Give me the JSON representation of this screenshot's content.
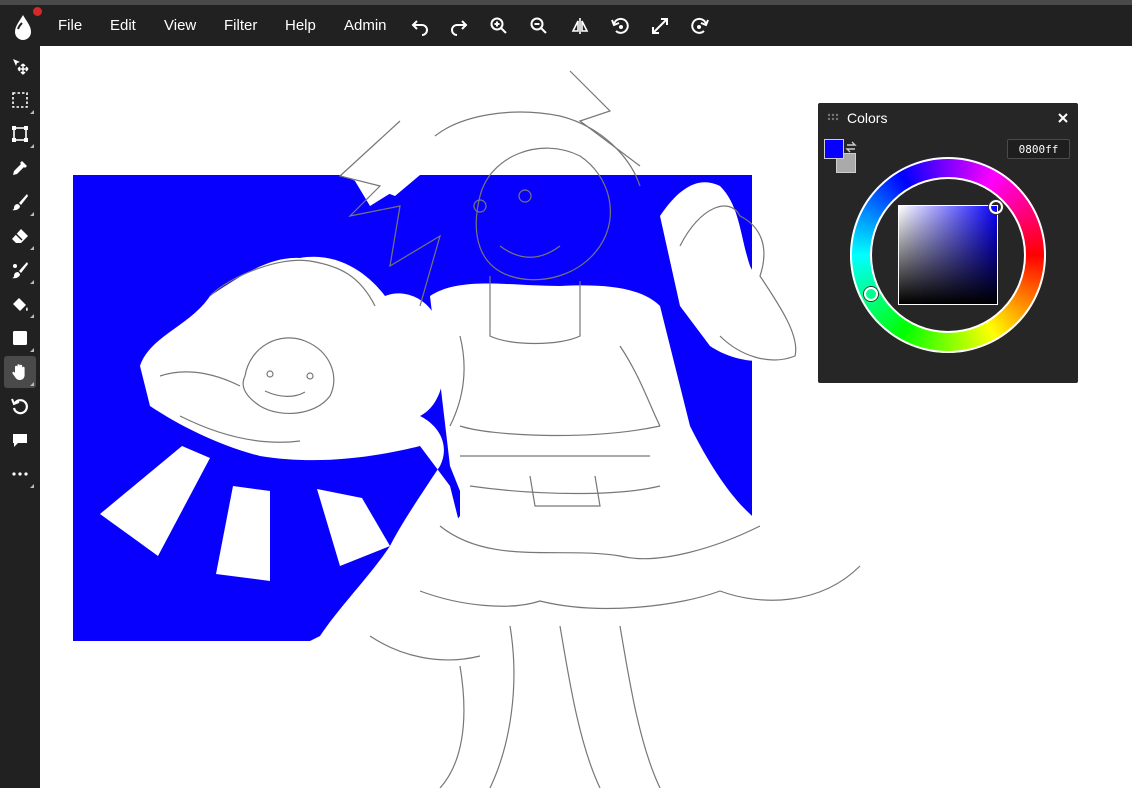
{
  "menu": {
    "items": [
      "File",
      "Edit",
      "View",
      "Filter",
      "Help",
      "Admin"
    ]
  },
  "toolbar_icons": [
    "undo-icon",
    "redo-icon",
    "zoom-in-icon",
    "zoom-out-icon",
    "flip-icon",
    "rotate-left-icon",
    "fullscreen-icon",
    "rotate-right-icon"
  ],
  "tools": [
    "move-tool",
    "select-tool",
    "transform-tool",
    "eyedropper-tool",
    "brush-tool",
    "eraser-tool",
    "smudge-tool",
    "fill-tool",
    "shape-tool",
    "hand-tool",
    "rotate-tool",
    "comment-tool",
    "more-tools"
  ],
  "active_tool": "hand-tool",
  "colors_panel": {
    "title": "Colors",
    "hex_value": "0800ff",
    "foreground": "#0800ff",
    "background": "#aaaaaa"
  },
  "canvas": {
    "fill_color": "#0800ff"
  }
}
